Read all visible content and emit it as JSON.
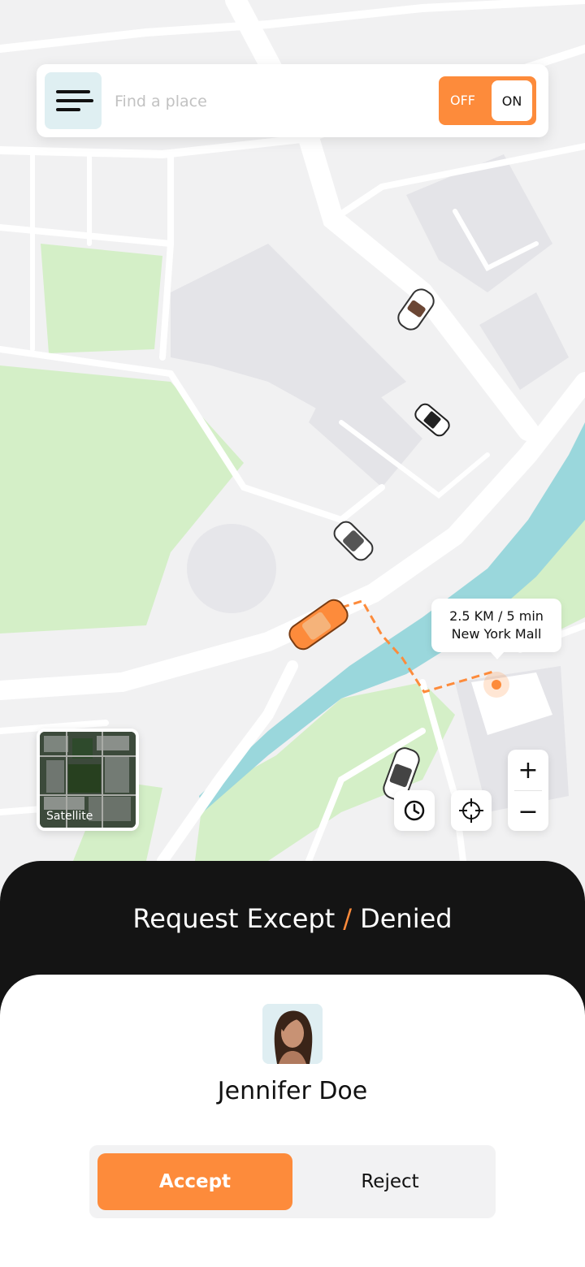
{
  "search": {
    "placeholder": "Find a place"
  },
  "toggle": {
    "off_label": "OFF",
    "on_label": "ON",
    "state": "on"
  },
  "route_info": {
    "distance_time": "2.5 KM / 5 min",
    "destination": "New York Mall"
  },
  "map_type": {
    "label": "Satellite"
  },
  "zoom": {
    "in_label": "+",
    "out_label": "−"
  },
  "sheet": {
    "title_left": "Request Except",
    "title_sep": "/",
    "title_right": "Denied",
    "rider_name": "Jennifer Doe",
    "accept_label": "Accept",
    "reject_label": "Reject"
  },
  "colors": {
    "accent": "#fd8b3b",
    "dark": "#141414",
    "water": "#9ad7dc",
    "park": "#d4efc7"
  },
  "icons": [
    "menu-icon",
    "clock-icon",
    "crosshair-icon",
    "satellite-thumbnail",
    "car-icon"
  ]
}
